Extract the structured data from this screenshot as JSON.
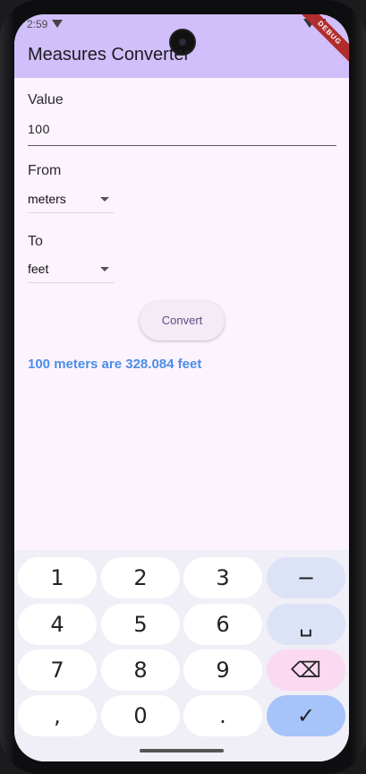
{
  "status": {
    "time": "2:59"
  },
  "debug_banner": "DEBUG",
  "app": {
    "title": "Measures Converter"
  },
  "form": {
    "value_label": "Value",
    "value": "100",
    "from_label": "From",
    "from_value": "meters",
    "to_label": "To",
    "to_value": "feet",
    "convert_label": "Convert",
    "result": "100 meters are 328.084 feet"
  },
  "colors": {
    "appbar": "#d1bffb",
    "result": "#4b8ee8",
    "background": "#fdf3fe"
  },
  "keyboard": {
    "keys": [
      "1",
      "2",
      "3",
      "−",
      "4",
      "5",
      "6",
      "␣",
      "7",
      "8",
      "9",
      "⌫",
      ",",
      "0",
      ".",
      "✓"
    ]
  }
}
